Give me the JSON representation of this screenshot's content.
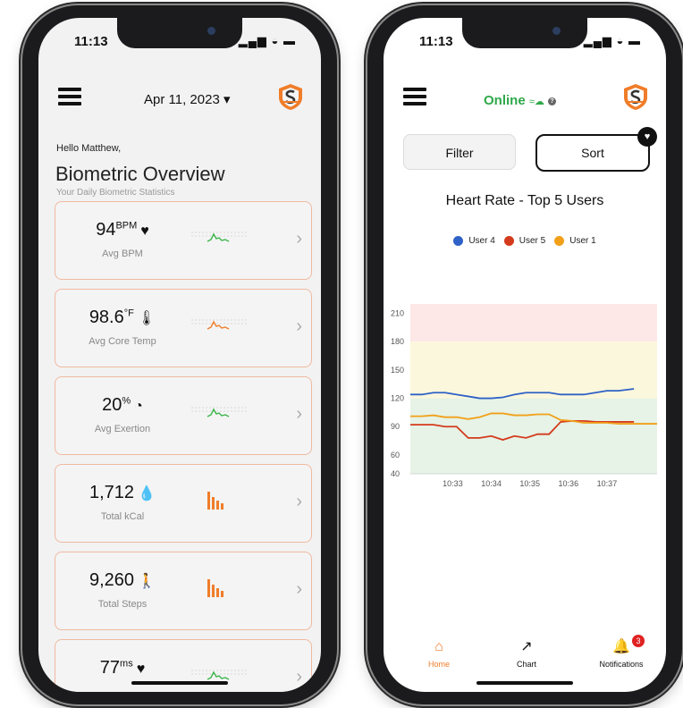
{
  "left_phone": {
    "status": {
      "time": "11:13",
      "icons": "▂▄▆ ◒ ▬"
    },
    "header": {
      "date": "Apr 11, 2023",
      "dropdown_glyph": "▾"
    },
    "greeting": "Hello Matthew,",
    "title": "Biometric Overview",
    "subtitle": "Your Daily Biometric Statistics",
    "cards": [
      {
        "value": "94",
        "unit": "BPM",
        "icon": "♥",
        "icon_name": "heart-icon",
        "label": "Avg BPM",
        "chart": "line-green"
      },
      {
        "value": "98.6",
        "unit": "°F",
        "icon": "🌡",
        "icon_name": "thermometer-icon",
        "label": "Avg Core Temp",
        "chart": "line-orange-green"
      },
      {
        "value": "20",
        "unit": "%",
        "icon": "◔",
        "icon_name": "gauge-icon",
        "label": "Avg Exertion",
        "chart": "line-green"
      },
      {
        "value": "1,712",
        "unit": "",
        "icon": "💧",
        "icon_name": "drop-icon",
        "label": "Total kCal",
        "chart": "bars-orange"
      },
      {
        "value": "9,260",
        "unit": "",
        "icon": "🚶",
        "icon_name": "walking-icon",
        "label": "Total Steps",
        "chart": "bars-orange"
      },
      {
        "value": "77",
        "unit": "ms",
        "icon": "♥",
        "icon_name": "heart-pulse-icon",
        "label": "",
        "chart": "line-green"
      }
    ],
    "chevron": "›"
  },
  "right_phone": {
    "status": {
      "time": "11:13",
      "icons": "▂▄▆ ◒ ▬"
    },
    "header": {
      "status": "Online",
      "status_symbol": "≈☁",
      "info": "?"
    },
    "filter_label": "Filter",
    "sort_label": "Sort",
    "sort_badge": "♥",
    "tabs": [
      {
        "label": "Home",
        "icon": "⌂"
      },
      {
        "label": "Chart",
        "icon": "↗"
      },
      {
        "label": "Notifications",
        "icon": "🔔",
        "badge": "3"
      }
    ]
  },
  "colors": {
    "accent": "#f07d2a",
    "online": "#2ea84a",
    "card_border": "#f0b9a0",
    "zone_red": "#fde7e7",
    "zone_yellow": "#fbf7dc",
    "zone_green": "#e6f3e6"
  },
  "chart_data": {
    "type": "line",
    "title": "Heart Rate - Top 5 Users",
    "xlabel": "",
    "ylabel": "",
    "x_ticks": [
      "10:33",
      "10:34",
      "10:35",
      "10:36",
      "10:37"
    ],
    "y_ticks": [
      40,
      60,
      90,
      120,
      150,
      180,
      210
    ],
    "ylim": [
      40,
      220
    ],
    "xlim": [
      10.33,
      10.37
    ],
    "grid": false,
    "legend_position": "top",
    "zones": [
      {
        "from": 180,
        "to": 220,
        "color": "#fde7e7"
      },
      {
        "from": 120,
        "to": 180,
        "color": "#fbf7dc"
      },
      {
        "from": 40,
        "to": 120,
        "color": "#e6f3e6"
      }
    ],
    "series": [
      {
        "name": "User 4",
        "color": "#2f62c6",
        "points": [
          [
            0.0,
            124
          ],
          [
            0.3,
            124
          ],
          [
            0.6,
            126
          ],
          [
            0.9,
            126
          ],
          [
            1.2,
            124
          ],
          [
            1.5,
            122
          ],
          [
            1.8,
            120
          ],
          [
            2.1,
            120
          ],
          [
            2.4,
            121
          ],
          [
            2.7,
            124
          ],
          [
            3.0,
            126
          ],
          [
            3.3,
            126
          ],
          [
            3.6,
            126
          ],
          [
            3.9,
            124
          ],
          [
            4.2,
            124
          ],
          [
            4.5,
            124
          ],
          [
            4.8,
            126
          ],
          [
            5.1,
            128
          ],
          [
            5.4,
            128
          ],
          [
            5.8,
            130
          ]
        ]
      },
      {
        "name": "User 5",
        "color": "#d43a1c",
        "points": [
          [
            0.0,
            92
          ],
          [
            0.3,
            92
          ],
          [
            0.6,
            92
          ],
          [
            0.9,
            90
          ],
          [
            1.2,
            90
          ],
          [
            1.5,
            78
          ],
          [
            1.8,
            78
          ],
          [
            2.1,
            80
          ],
          [
            2.4,
            76
          ],
          [
            2.7,
            80
          ],
          [
            3.0,
            78
          ],
          [
            3.3,
            82
          ],
          [
            3.6,
            82
          ],
          [
            3.9,
            95
          ],
          [
            4.2,
            96
          ],
          [
            4.5,
            96
          ],
          [
            4.8,
            95
          ],
          [
            5.1,
            95
          ],
          [
            5.4,
            95
          ],
          [
            5.8,
            95
          ]
        ]
      },
      {
        "name": "User 1",
        "color": "#f2a019",
        "points": [
          [
            0.0,
            101
          ],
          [
            0.3,
            101
          ],
          [
            0.6,
            102
          ],
          [
            0.9,
            100
          ],
          [
            1.2,
            100
          ],
          [
            1.5,
            98
          ],
          [
            1.8,
            100
          ],
          [
            2.1,
            104
          ],
          [
            2.4,
            104
          ],
          [
            2.7,
            102
          ],
          [
            3.0,
            102
          ],
          [
            3.3,
            103
          ],
          [
            3.6,
            103
          ],
          [
            3.9,
            97
          ],
          [
            4.2,
            96
          ],
          [
            4.5,
            94
          ],
          [
            4.8,
            94
          ],
          [
            5.1,
            94
          ],
          [
            5.4,
            93
          ],
          [
            5.8,
            93
          ],
          [
            6.2,
            93
          ],
          [
            6.4,
            93
          ]
        ]
      }
    ]
  }
}
